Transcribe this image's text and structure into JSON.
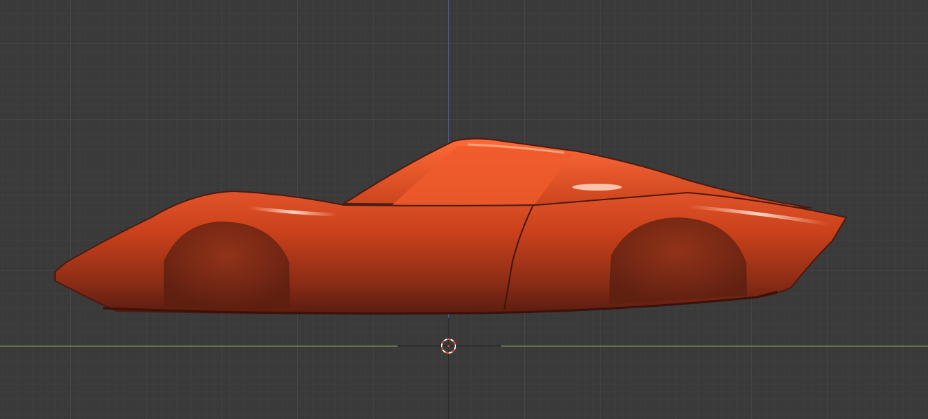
{
  "viewport": {
    "view": "side-orthographic",
    "background_color": "#3a3a3a",
    "grid_minor_color": "#3e3e3e",
    "grid_major_color": "#464646"
  },
  "axes": {
    "z_axis_color": "#5a72b8",
    "y_axis_color": "#7fa64a"
  },
  "object": {
    "name": "car-body",
    "material_color": "#c8401a",
    "highlight_color": "#ff7a4a",
    "shadow_color": "#5a1c10"
  },
  "cursor": {
    "name": "3d-cursor",
    "ring_color": "#e05030",
    "ring_alt_color": "#ffffff"
  }
}
